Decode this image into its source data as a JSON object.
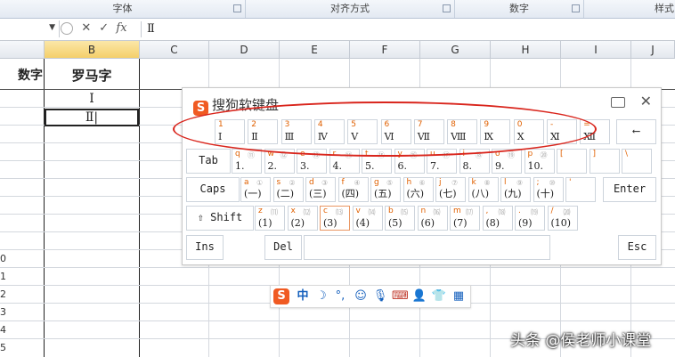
{
  "ribbon": {
    "groups": [
      "字体",
      "对齐方式",
      "数字",
      "样式"
    ]
  },
  "formula_bar": {
    "name_box": "",
    "cancel": "✕",
    "enter": "✓",
    "fx": "fx",
    "value": "Ⅱ"
  },
  "columns": [
    "",
    "B",
    "C",
    "D",
    "E",
    "F",
    "G",
    "H",
    "I",
    "J"
  ],
  "column_a_partial": "",
  "headers": {
    "col_a": "数字",
    "col_b": "罗马字"
  },
  "cells_b": [
    "Ⅰ",
    "Ⅱ"
  ],
  "row_labels": [
    "0",
    "1",
    "2",
    "3",
    "4",
    "5"
  ],
  "keyboard": {
    "title": "搜狗软键盘",
    "logo": "S",
    "close": "✕",
    "row1": [
      {
        "top": "1",
        "bottom": "Ⅰ"
      },
      {
        "top": "2",
        "bottom": "Ⅱ"
      },
      {
        "top": "3",
        "bottom": "Ⅲ"
      },
      {
        "top": "4",
        "bottom": "Ⅳ"
      },
      {
        "top": "5",
        "bottom": "Ⅴ"
      },
      {
        "top": "6",
        "bottom": "Ⅵ"
      },
      {
        "top": "7",
        "bottom": "Ⅶ"
      },
      {
        "top": "8",
        "bottom": "Ⅷ"
      },
      {
        "top": "9",
        "bottom": "Ⅸ"
      },
      {
        "top": "0",
        "bottom": "Ⅹ"
      },
      {
        "top": "-",
        "bottom": "Ⅺ"
      },
      {
        "top": "=",
        "bottom": "Ⅻ"
      }
    ],
    "backspace": "⟵",
    "row2": [
      {
        "top": "q",
        "circ": "⑪",
        "bottom": "1."
      },
      {
        "top": "w",
        "circ": "⑫",
        "bottom": "2."
      },
      {
        "top": "e",
        "circ": "⑬",
        "bottom": "3."
      },
      {
        "top": "r",
        "circ": "⑭",
        "bottom": "4."
      },
      {
        "top": "t",
        "circ": "⑮",
        "bottom": "5."
      },
      {
        "top": "y",
        "circ": "⑯",
        "bottom": "6."
      },
      {
        "top": "u",
        "circ": "⑰",
        "bottom": "7."
      },
      {
        "top": "i",
        "circ": "⑱",
        "bottom": "8."
      },
      {
        "top": "o",
        "circ": "⑲",
        "bottom": "9."
      },
      {
        "top": "p",
        "circ": "⑳",
        "bottom": "10."
      },
      {
        "top": "[",
        "circ": "",
        "bottom": ""
      },
      {
        "top": "]",
        "circ": "",
        "bottom": ""
      },
      {
        "top": "\\",
        "circ": "",
        "bottom": ""
      }
    ],
    "tab": "Tab",
    "row3": [
      {
        "top": "a",
        "circ": "①",
        "bottom": "(一)"
      },
      {
        "top": "s",
        "circ": "②",
        "bottom": "(二)"
      },
      {
        "top": "d",
        "circ": "③",
        "bottom": "(三)"
      },
      {
        "top": "f",
        "circ": "④",
        "bottom": "(四)"
      },
      {
        "top": "g",
        "circ": "⑤",
        "bottom": "(五)"
      },
      {
        "top": "h",
        "circ": "⑥",
        "bottom": "(六)"
      },
      {
        "top": "j",
        "circ": "⑦",
        "bottom": "(七)"
      },
      {
        "top": "k",
        "circ": "⑧",
        "bottom": "(八)"
      },
      {
        "top": "l",
        "circ": "⑨",
        "bottom": "(九)"
      },
      {
        "top": ";",
        "circ": "⑩",
        "bottom": "(十)"
      },
      {
        "top": "'",
        "circ": "",
        "bottom": ""
      }
    ],
    "caps": "Caps",
    "enter": "Enter",
    "row4": [
      {
        "top": "z",
        "circ": "⑾",
        "bottom": "(1)"
      },
      {
        "top": "x",
        "circ": "⑿",
        "bottom": "(2)"
      },
      {
        "top": "c",
        "circ": "⒀",
        "bottom": "(3)"
      },
      {
        "top": "v",
        "circ": "⒁",
        "bottom": "(4)"
      },
      {
        "top": "b",
        "circ": "⒂",
        "bottom": "(5)"
      },
      {
        "top": "n",
        "circ": "⒃",
        "bottom": "(6)"
      },
      {
        "top": "m",
        "circ": "⒄",
        "bottom": "(7)"
      },
      {
        "top": ",",
        "circ": "⒅",
        "bottom": "(8)"
      },
      {
        "top": ".",
        "circ": "⒆",
        "bottom": "(9)"
      },
      {
        "top": "/",
        "circ": "⒇",
        "bottom": "(10)"
      }
    ],
    "shift": "⇧ Shift",
    "ins": "Ins",
    "del": "Del",
    "esc": "Esc"
  },
  "ime_toolbar": {
    "logo": "S",
    "items": [
      "中",
      "☽",
      "°,",
      "☺",
      "🎙",
      "⌨",
      "👤",
      "👕",
      "▦"
    ]
  },
  "watermark": "头条 @侯老师小课堂"
}
